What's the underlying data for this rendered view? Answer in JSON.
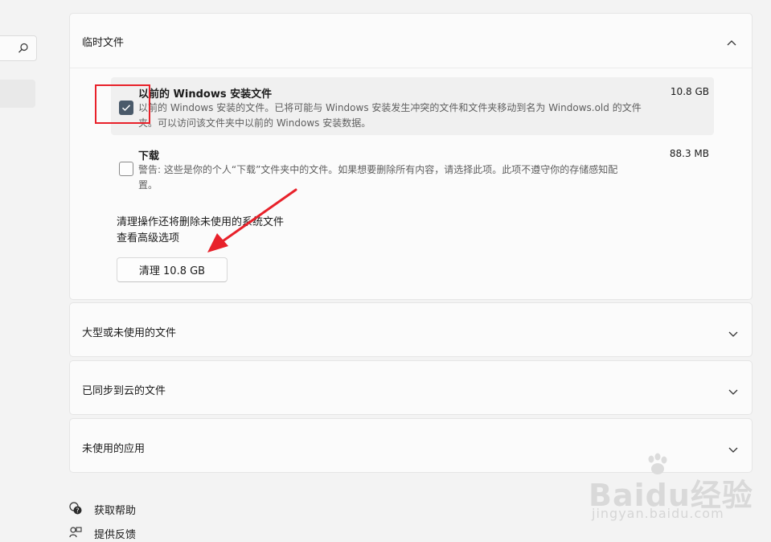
{
  "sidebar": {
    "search_icon": "search-icon"
  },
  "temp_files": {
    "title": "临时文件",
    "items": [
      {
        "title": "以前的 Windows 安装文件",
        "size": "10.8 GB",
        "checked": true,
        "desc_line1": "以前的 Windows 安装的文件。已将可能与 Windows 安装发生冲突的文件和文件夹移动到名为 Windows.old 的文件",
        "desc_line2": "夹。可以访问该文件夹中以前的 Windows 安装数据。"
      },
      {
        "title": "下载",
        "size": "88.3 MB",
        "checked": false,
        "desc_line1": "警告: 这些是你的个人“下载”文件夹中的文件。如果想要删除所有内容，请选择此项。此项不遵守你的存储感知配",
        "desc_line2": "置。"
      }
    ],
    "note": "清理操作还将删除未使用的系统文件",
    "advanced_link": "查看高级选项",
    "cleanup_button": "清理 10.8 GB"
  },
  "sections": [
    {
      "title": "大型或未使用的文件"
    },
    {
      "title": "已同步到云的文件"
    },
    {
      "title": "未使用的应用"
    }
  ],
  "footer": {
    "help": "获取帮助",
    "feedback": "提供反馈"
  },
  "watermark": {
    "logo": "Baidu经验",
    "url": "jingyan.baidu.com"
  },
  "colors": {
    "accent_checkbox": "#4a5a6a",
    "highlight_box": "#e8212a",
    "annotation_arrow": "#e8212a"
  }
}
